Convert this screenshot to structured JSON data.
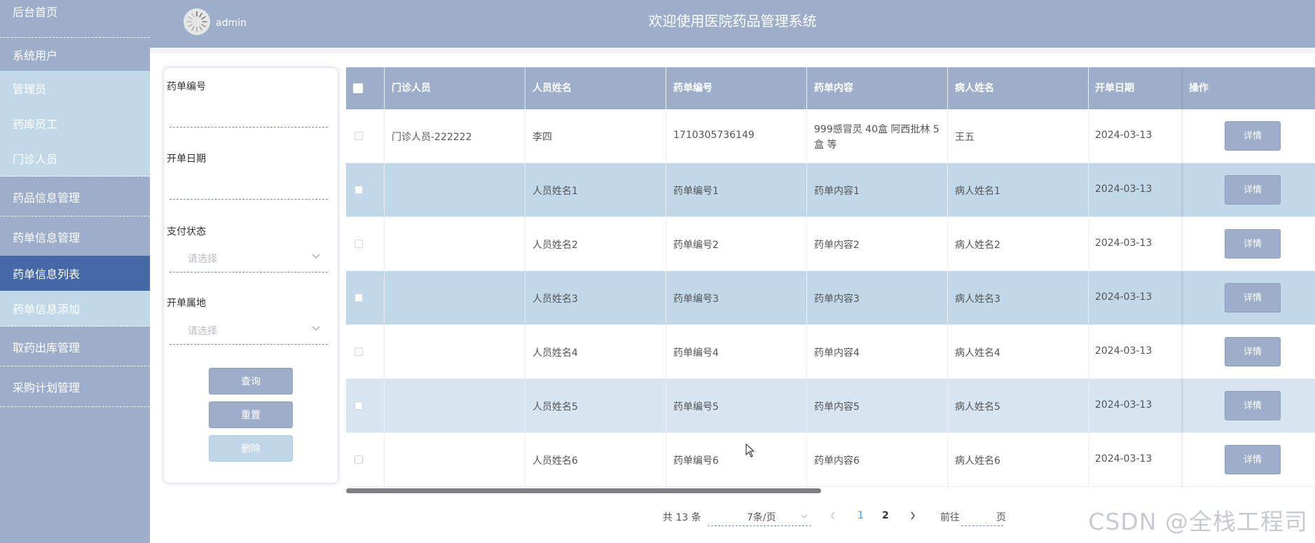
{
  "sidebar": {
    "items": [
      {
        "label": "后台首页",
        "type": "main"
      },
      {
        "label": "系统用户",
        "type": "main"
      },
      {
        "label": "管理员",
        "type": "sub"
      },
      {
        "label": "药库员工",
        "type": "sub"
      },
      {
        "label": "门诊人员",
        "type": "sub"
      },
      {
        "label": "药品信息管理",
        "type": "main"
      },
      {
        "label": "药单信息管理",
        "type": "main"
      },
      {
        "label": "药单信息列表",
        "type": "active"
      },
      {
        "label": "药单信息添加",
        "type": "sub"
      },
      {
        "label": "取药出库管理",
        "type": "main"
      },
      {
        "label": "采购计划管理",
        "type": "main"
      }
    ]
  },
  "header": {
    "username": "admin",
    "title": "欢迎使用医院药品管理系统"
  },
  "search": {
    "order_no_label": "药单编号",
    "order_no_value": "",
    "date_label": "开单日期",
    "date_value": "",
    "pay_status_label": "支付状态",
    "pay_status_placeholder": "请选择",
    "location_label": "开单属地",
    "location_placeholder": "请选择",
    "query_button": "查询",
    "reset_button": "重置",
    "delete_button": "删除"
  },
  "table": {
    "columns": [
      "门诊人员",
      "人员姓名",
      "药单编号",
      "药单内容",
      "病人姓名",
      "开单日期",
      "操作"
    ],
    "detail_label": "详情",
    "rows": [
      {
        "staff": "门诊人员-222222",
        "name": "李四",
        "order_no": "1710305736149",
        "content": "999感冒灵 40盒 阿西批林 5盒 等",
        "patient": "王五",
        "date": "2024-03-13"
      },
      {
        "staff": "",
        "name": "人员姓名1",
        "order_no": "药单编号1",
        "content": "药单内容1",
        "patient": "病人姓名1",
        "date": "2024-03-13"
      },
      {
        "staff": "",
        "name": "人员姓名2",
        "order_no": "药单编号2",
        "content": "药单内容2",
        "patient": "病人姓名2",
        "date": "2024-03-13"
      },
      {
        "staff": "",
        "name": "人员姓名3",
        "order_no": "药单编号3",
        "content": "药单内容3",
        "patient": "病人姓名3",
        "date": "2024-03-13"
      },
      {
        "staff": "",
        "name": "人员姓名4",
        "order_no": "药单编号4",
        "content": "药单内容4",
        "patient": "病人姓名4",
        "date": "2024-03-13"
      },
      {
        "staff": "",
        "name": "人员姓名5",
        "order_no": "药单编号5",
        "content": "药单内容5",
        "patient": "病人姓名5",
        "date": "2024-03-13"
      },
      {
        "staff": "",
        "name": "人员姓名6",
        "order_no": "药单编号6",
        "content": "药单内容6",
        "patient": "病人姓名6",
        "date": "2024-03-13"
      }
    ]
  },
  "pagination": {
    "total": "共 13 条",
    "page_size": "7条/页",
    "pages": [
      "1",
      "2"
    ],
    "current_page": "1",
    "goto_label": "前往",
    "page_suffix": "页"
  },
  "watermark": "CSDN @全栈工程司",
  "colors": {
    "sidebar_bg": "#9caec9",
    "sidebar_sub_bg": "#c0d8e8",
    "sidebar_active_bg": "#4469a6",
    "row_stripe": "#c0d8e8",
    "row_stripe_light": "#d6e5f0",
    "accent_link": "#409eff"
  },
  "icons": {
    "avatar": "avatar-icon",
    "select_arrow": "chevron-down-icon",
    "prev": "chevron-left-icon",
    "next": "chevron-right-icon"
  }
}
